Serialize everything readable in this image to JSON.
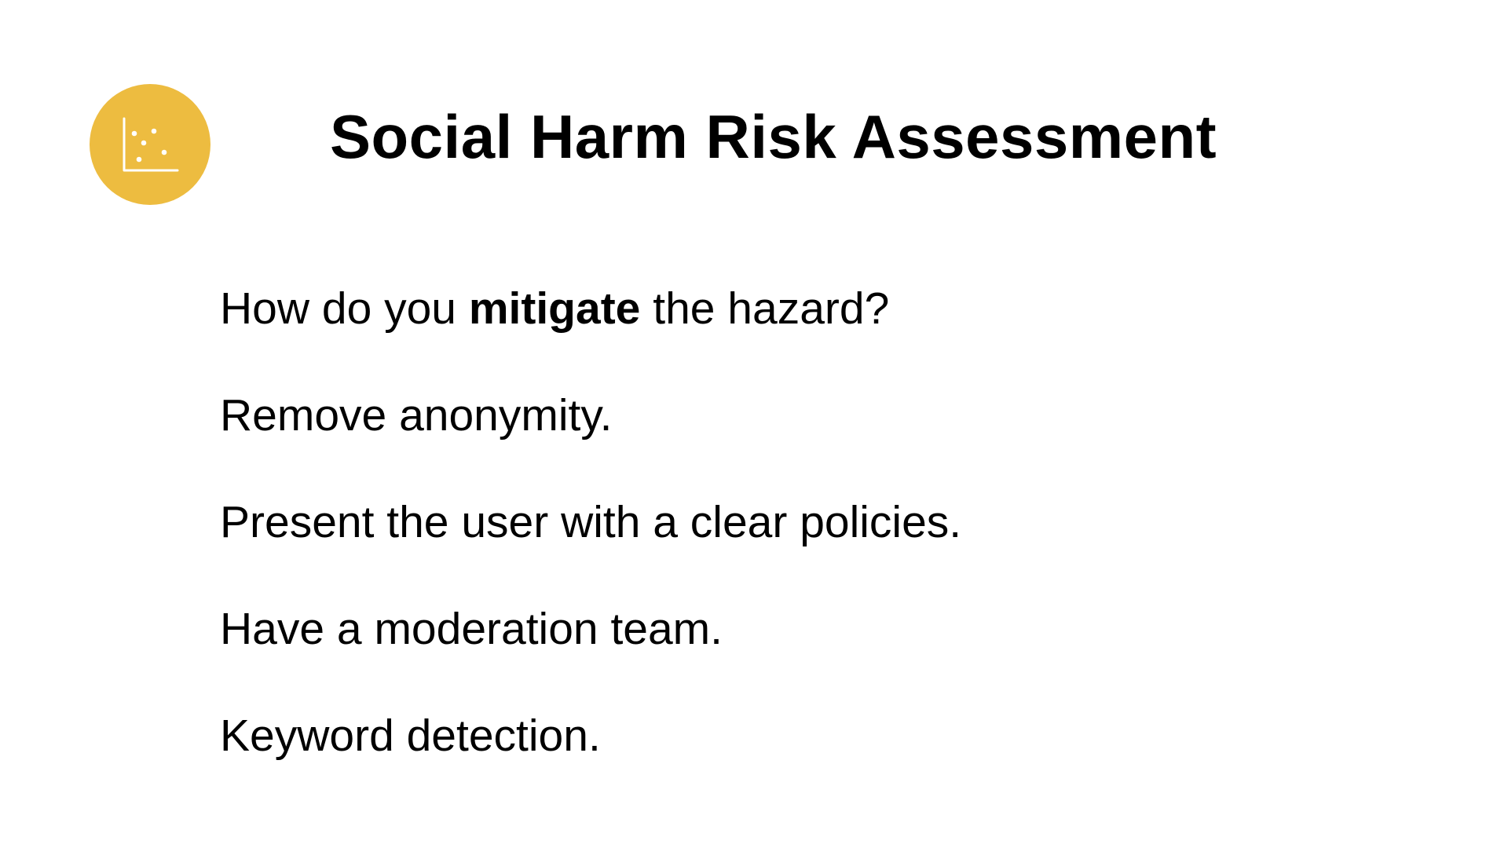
{
  "slide": {
    "title": "Social Harm Risk Assessment",
    "logo_icon": "scatter-plot-icon",
    "accent_color": "#EDBC40",
    "question": {
      "before": "How do you ",
      "emphasis": "mitigate",
      "after": " the hazard?"
    },
    "items": [
      "Remove anonymity.",
      "Present the user with a clear policies.",
      "Have a moderation team.",
      "Keyword detection."
    ]
  }
}
